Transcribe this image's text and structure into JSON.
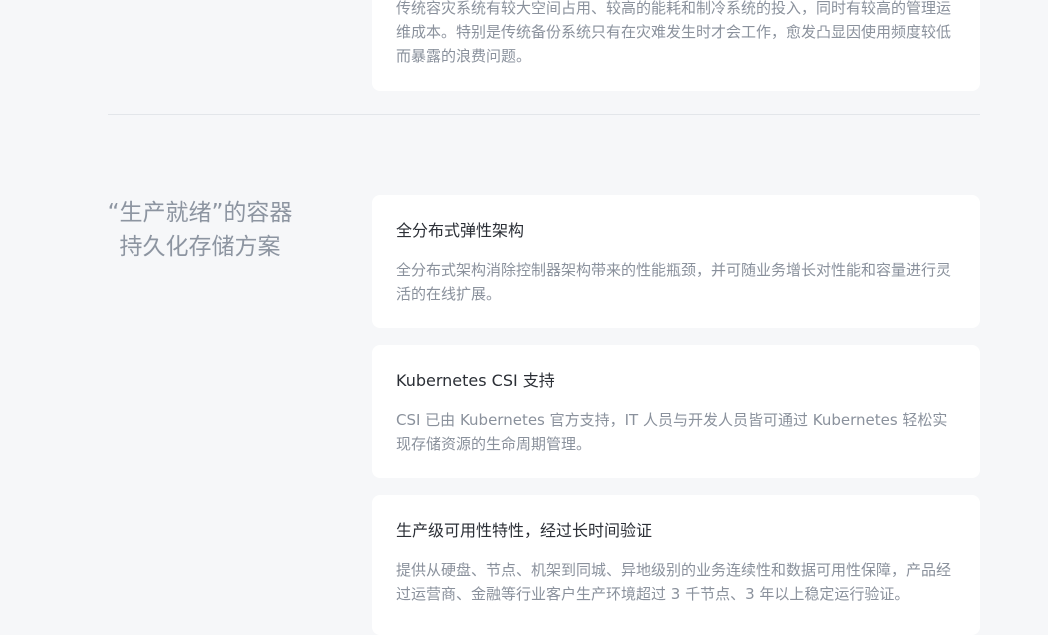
{
  "top_card": {
    "desc": "传统容灾系统有较大空间占用、较高的能耗和制冷系统的投入，同时有较高的管理运维成本。特别是传统备份系统只有在灾难发生时才会工作，愈发凸显因使用频度较低而暴露的浪费问题。"
  },
  "section": {
    "title_line1": "“生产就绪”的容器",
    "title_line2": "持久化存储方案"
  },
  "features": [
    {
      "title": "全分布式弹性架构",
      "desc": "全分布式架构消除控制器架构带来的性能瓶颈，并可随业务增长对性能和容量进行灵活的在线扩展。"
    },
    {
      "title": "Kubernetes CSI 支持",
      "desc": "CSI 已由 Kubernetes 官方支持，IT 人员与开发人员皆可通过 Kubernetes 轻松实现存储资源的生命周期管理。"
    },
    {
      "title": "生产级可用性特性，经过长时间验证",
      "desc": "提供从硬盘、节点、机架到同城、异地级别的业务连续性和数据可用性保障，产品经过运营商、金融等行业客户生产环境超过 3 千节点、3 年以上稳定运行验证。"
    }
  ]
}
